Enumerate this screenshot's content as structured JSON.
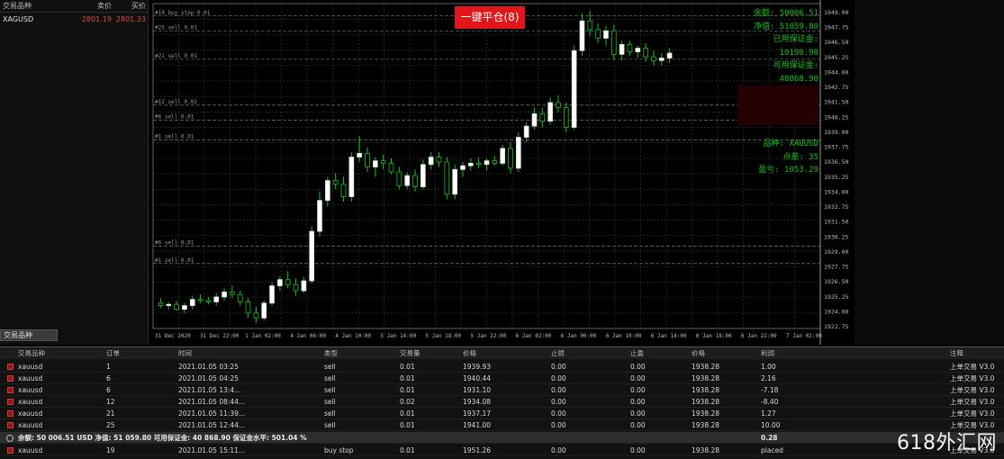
{
  "close_all_label": "一键平仓(8)",
  "account_info": [
    {
      "text": "余额: 50006.51",
      "color": "green"
    },
    {
      "text": "净值: 51059.80",
      "color": "green"
    },
    {
      "text": "已用保证金: 10190.90",
      "color": "green"
    },
    {
      "text": "可用保证金: 40868.90",
      "color": "green"
    },
    {
      "text": "",
      "color": "red"
    },
    {
      "text": "",
      "color": "red"
    },
    {
      "text": "",
      "color": "red"
    },
    {
      "text": "",
      "color": "green"
    },
    {
      "text": "品种: XAUUSD",
      "color": "green"
    },
    {
      "text": "点差: 35",
      "color": "green"
    },
    {
      "text": "盈亏: 1053.29",
      "color": "green"
    }
  ],
  "colors": {
    "bull": "#ffffff",
    "bear": "#13c413",
    "grid": "#3a3a3a",
    "accent": "#e0161b"
  },
  "market_watch": {
    "header": {
      "symbol": "交易品种",
      "bid": "卖价",
      "ask": "买价"
    },
    "rows": [
      {
        "symbol": "XAGUSD",
        "bid": "2801.19",
        "ask": "2801.33"
      }
    ],
    "footer": "交易品种"
  },
  "trade_table": {
    "columns": [
      "交易品种",
      "订单",
      "时间",
      "类型",
      "交易量",
      "价格",
      "止损",
      "止盈",
      "价格",
      "利润",
      "注释"
    ],
    "rows": [
      {
        "symbol": "xauusd",
        "order": "1",
        "time": "2021.01.05 03:25",
        "type": "sell",
        "volume": "0.01",
        "open": "1939.93",
        "sl": "0.00",
        "tp": "0.00",
        "price": "1938.28",
        "profit": "1.00",
        "comment": "上单交易 V3.0"
      },
      {
        "symbol": "xauusd",
        "order": "6",
        "time": "2021.01.05 04:25",
        "type": "sell",
        "volume": "0.01",
        "open": "1940.44",
        "sl": "0.00",
        "tp": "0.00",
        "price": "1938.28",
        "profit": "2.16",
        "comment": "上单交易 V3.0"
      },
      {
        "symbol": "xauusd",
        "order": "6",
        "time": "2021.01.05 13:4...",
        "type": "sell",
        "volume": "0.01",
        "open": "1931.10",
        "sl": "0.00",
        "tp": "0.00",
        "price": "1938.28",
        "profit": "-7.18",
        "comment": "上单交易 V3.0"
      },
      {
        "symbol": "xauusd",
        "order": "12",
        "time": "2021.01.05 08:44...",
        "type": "sell",
        "volume": "0.02",
        "open": "1934.08",
        "sl": "0.00",
        "tp": "0.00",
        "price": "1938.28",
        "profit": "-8.40",
        "comment": "上单交易 V3.0"
      },
      {
        "symbol": "xauusd",
        "order": "21",
        "time": "2021.01.05 11:39...",
        "type": "sell",
        "volume": "0.01",
        "open": "1937.17",
        "sl": "0.00",
        "tp": "0.00",
        "price": "1938.28",
        "profit": "1.27",
        "comment": "上单交易 V3.0"
      },
      {
        "symbol": "xauusd",
        "order": "25",
        "time": "2021.01.05 12:44...",
        "type": "sell",
        "volume": "0.01",
        "open": "1941.00",
        "sl": "0.00",
        "tp": "0.00",
        "price": "1938.28",
        "profit": "10.00",
        "comment": "上单交易 V3.0"
      }
    ],
    "summary": {
      "text": "余额: 50 006.51 USD  净值: 51 059.80  可用保证金: 40 868.90  保证金水平: 501.04 %",
      "profit": "0.28"
    },
    "extra_row": {
      "symbol": "xauusd",
      "order": "19",
      "time": "2021.01.05 15:11...",
      "type": "buy stop",
      "volume": "0.01",
      "open": "1951.26",
      "sl": "0.00",
      "tp": "0.00",
      "price": "1938.28",
      "profit": "placed",
      "comment": "上单交易 V3.0"
    }
  },
  "price_axis": [
    "1949.00",
    "1947.75",
    "1946.50",
    "1945.25",
    "1944.00",
    "1942.75",
    "1941.50",
    "1940.25",
    "1939.00",
    "1937.75",
    "1936.50",
    "1935.25",
    "1934.00",
    "1932.75",
    "1931.50",
    "1930.25",
    "1929.00",
    "1927.75",
    "1926.50",
    "1925.25",
    "1924.00",
    "1922.75"
  ],
  "time_axis": [
    "31 Dec 2020",
    "31 Dec 22:00",
    "1 Jan 02:00",
    "4 Jan 06:00",
    "4 Jan 10:00",
    "5 Jan 14:00",
    "5 Jan 18:00",
    "5 Jan 22:00",
    "6 Jan 02:00",
    "6 Jan 06:00",
    "6 Jan 10:00",
    "6 Jan 14:00",
    "6 Jan 18:00",
    "6 Jan 22:00",
    "7 Jan 02:00"
  ],
  "order_lines": [
    {
      "label": "#19 buy stop 0.01",
      "price": 1948.0
    },
    {
      "label": "#25 sell 0.01",
      "price": 1946.8
    },
    {
      "label": "#21 sell 0.01",
      "price": 1944.5
    },
    {
      "label": "#12 sell 0.02",
      "price": 1940.8
    },
    {
      "label": "#6 sell 0.01",
      "price": 1939.6
    },
    {
      "label": "#1 sell 0.01",
      "price": 1938.0
    },
    {
      "label": "#6 sell 0.01",
      "price": 1929.4
    },
    {
      "label": "#1 sell 0.01",
      "price": 1928.0
    }
  ],
  "chart_data": {
    "type": "candlestick",
    "ylim": [
      1922.75,
      1949.0
    ],
    "candles": [
      [
        1924.8,
        1925.2,
        1924.4,
        1924.6
      ],
      [
        1924.6,
        1924.9,
        1924.3,
        1924.7
      ],
      [
        1924.7,
        1925.0,
        1924.2,
        1924.3
      ],
      [
        1924.3,
        1924.8,
        1924.0,
        1924.6
      ],
      [
        1924.6,
        1925.4,
        1924.3,
        1925.1
      ],
      [
        1925.1,
        1925.5,
        1924.8,
        1925.0
      ],
      [
        1925.0,
        1925.3,
        1924.7,
        1924.9
      ],
      [
        1924.9,
        1925.6,
        1924.6,
        1925.3
      ],
      [
        1925.3,
        1926.0,
        1925.0,
        1925.7
      ],
      [
        1925.7,
        1926.2,
        1925.2,
        1925.5
      ],
      [
        1925.5,
        1925.8,
        1924.6,
        1924.9
      ],
      [
        1924.9,
        1925.2,
        1923.6,
        1924.0
      ],
      [
        1924.0,
        1924.5,
        1923.2,
        1923.6
      ],
      [
        1923.6,
        1925.0,
        1923.4,
        1924.8
      ],
      [
        1924.8,
        1926.5,
        1924.6,
        1926.2
      ],
      [
        1926.2,
        1927.0,
        1925.8,
        1926.7
      ],
      [
        1926.7,
        1927.4,
        1926.0,
        1926.3
      ],
      [
        1926.3,
        1926.8,
        1925.4,
        1925.8
      ],
      [
        1925.8,
        1926.9,
        1925.6,
        1926.6
      ],
      [
        1926.6,
        1931.0,
        1926.4,
        1930.6
      ],
      [
        1930.6,
        1933.8,
        1930.2,
        1933.1
      ],
      [
        1933.1,
        1935.0,
        1932.6,
        1934.7
      ],
      [
        1934.7,
        1935.3,
        1934.0,
        1934.4
      ],
      [
        1934.4,
        1935.0,
        1933.0,
        1933.4
      ],
      [
        1933.4,
        1937.0,
        1933.0,
        1936.6
      ],
      [
        1936.6,
        1938.3,
        1936.2,
        1936.9
      ],
      [
        1936.9,
        1937.4,
        1935.4,
        1935.8
      ],
      [
        1935.8,
        1936.6,
        1935.0,
        1936.3
      ],
      [
        1936.3,
        1936.8,
        1935.6,
        1936.1
      ],
      [
        1936.1,
        1936.5,
        1935.2,
        1935.4
      ],
      [
        1935.4,
        1935.8,
        1934.0,
        1934.3
      ],
      [
        1934.3,
        1935.4,
        1934.0,
        1935.1
      ],
      [
        1935.1,
        1935.6,
        1933.8,
        1934.2
      ],
      [
        1934.2,
        1936.4,
        1934.0,
        1936.0
      ],
      [
        1936.0,
        1937.0,
        1935.6,
        1936.6
      ],
      [
        1936.6,
        1937.0,
        1935.8,
        1936.2
      ],
      [
        1936.2,
        1936.6,
        1933.2,
        1933.6
      ],
      [
        1933.6,
        1936.0,
        1933.2,
        1935.6
      ],
      [
        1935.6,
        1936.2,
        1935.0,
        1935.9
      ],
      [
        1935.9,
        1936.5,
        1935.5,
        1936.1
      ],
      [
        1936.1,
        1936.6,
        1935.7,
        1936.0
      ],
      [
        1936.0,
        1936.5,
        1935.5,
        1936.3
      ],
      [
        1936.3,
        1936.7,
        1935.9,
        1936.1
      ],
      [
        1936.1,
        1937.6,
        1935.9,
        1937.3
      ],
      [
        1937.3,
        1937.8,
        1935.3,
        1935.7
      ],
      [
        1935.7,
        1938.6,
        1935.4,
        1938.2
      ],
      [
        1938.2,
        1939.4,
        1937.8,
        1939.1
      ],
      [
        1939.1,
        1940.6,
        1938.8,
        1940.1
      ],
      [
        1940.1,
        1940.6,
        1939.0,
        1939.5
      ],
      [
        1939.5,
        1941.4,
        1939.2,
        1941.0
      ],
      [
        1941.0,
        1941.6,
        1940.2,
        1940.6
      ],
      [
        1940.6,
        1941.0,
        1938.6,
        1939.0
      ],
      [
        1939.0,
        1945.6,
        1938.8,
        1945.2
      ],
      [
        1945.2,
        1948.2,
        1944.8,
        1947.6
      ],
      [
        1947.6,
        1948.4,
        1946.4,
        1946.9
      ],
      [
        1946.9,
        1947.4,
        1945.8,
        1946.2
      ],
      [
        1946.2,
        1947.2,
        1945.6,
        1946.8
      ],
      [
        1946.8,
        1947.3,
        1944.4,
        1944.9
      ],
      [
        1944.9,
        1946.0,
        1944.4,
        1945.7
      ],
      [
        1945.7,
        1946.0,
        1944.8,
        1945.1
      ],
      [
        1945.1,
        1945.6,
        1944.6,
        1945.4
      ],
      [
        1945.4,
        1945.8,
        1944.3,
        1944.7
      ],
      [
        1944.7,
        1945.2,
        1944.0,
        1944.4
      ],
      [
        1944.4,
        1945.0,
        1944.0,
        1944.6
      ],
      [
        1944.6,
        1945.4,
        1944.2,
        1945.0
      ]
    ]
  }
}
